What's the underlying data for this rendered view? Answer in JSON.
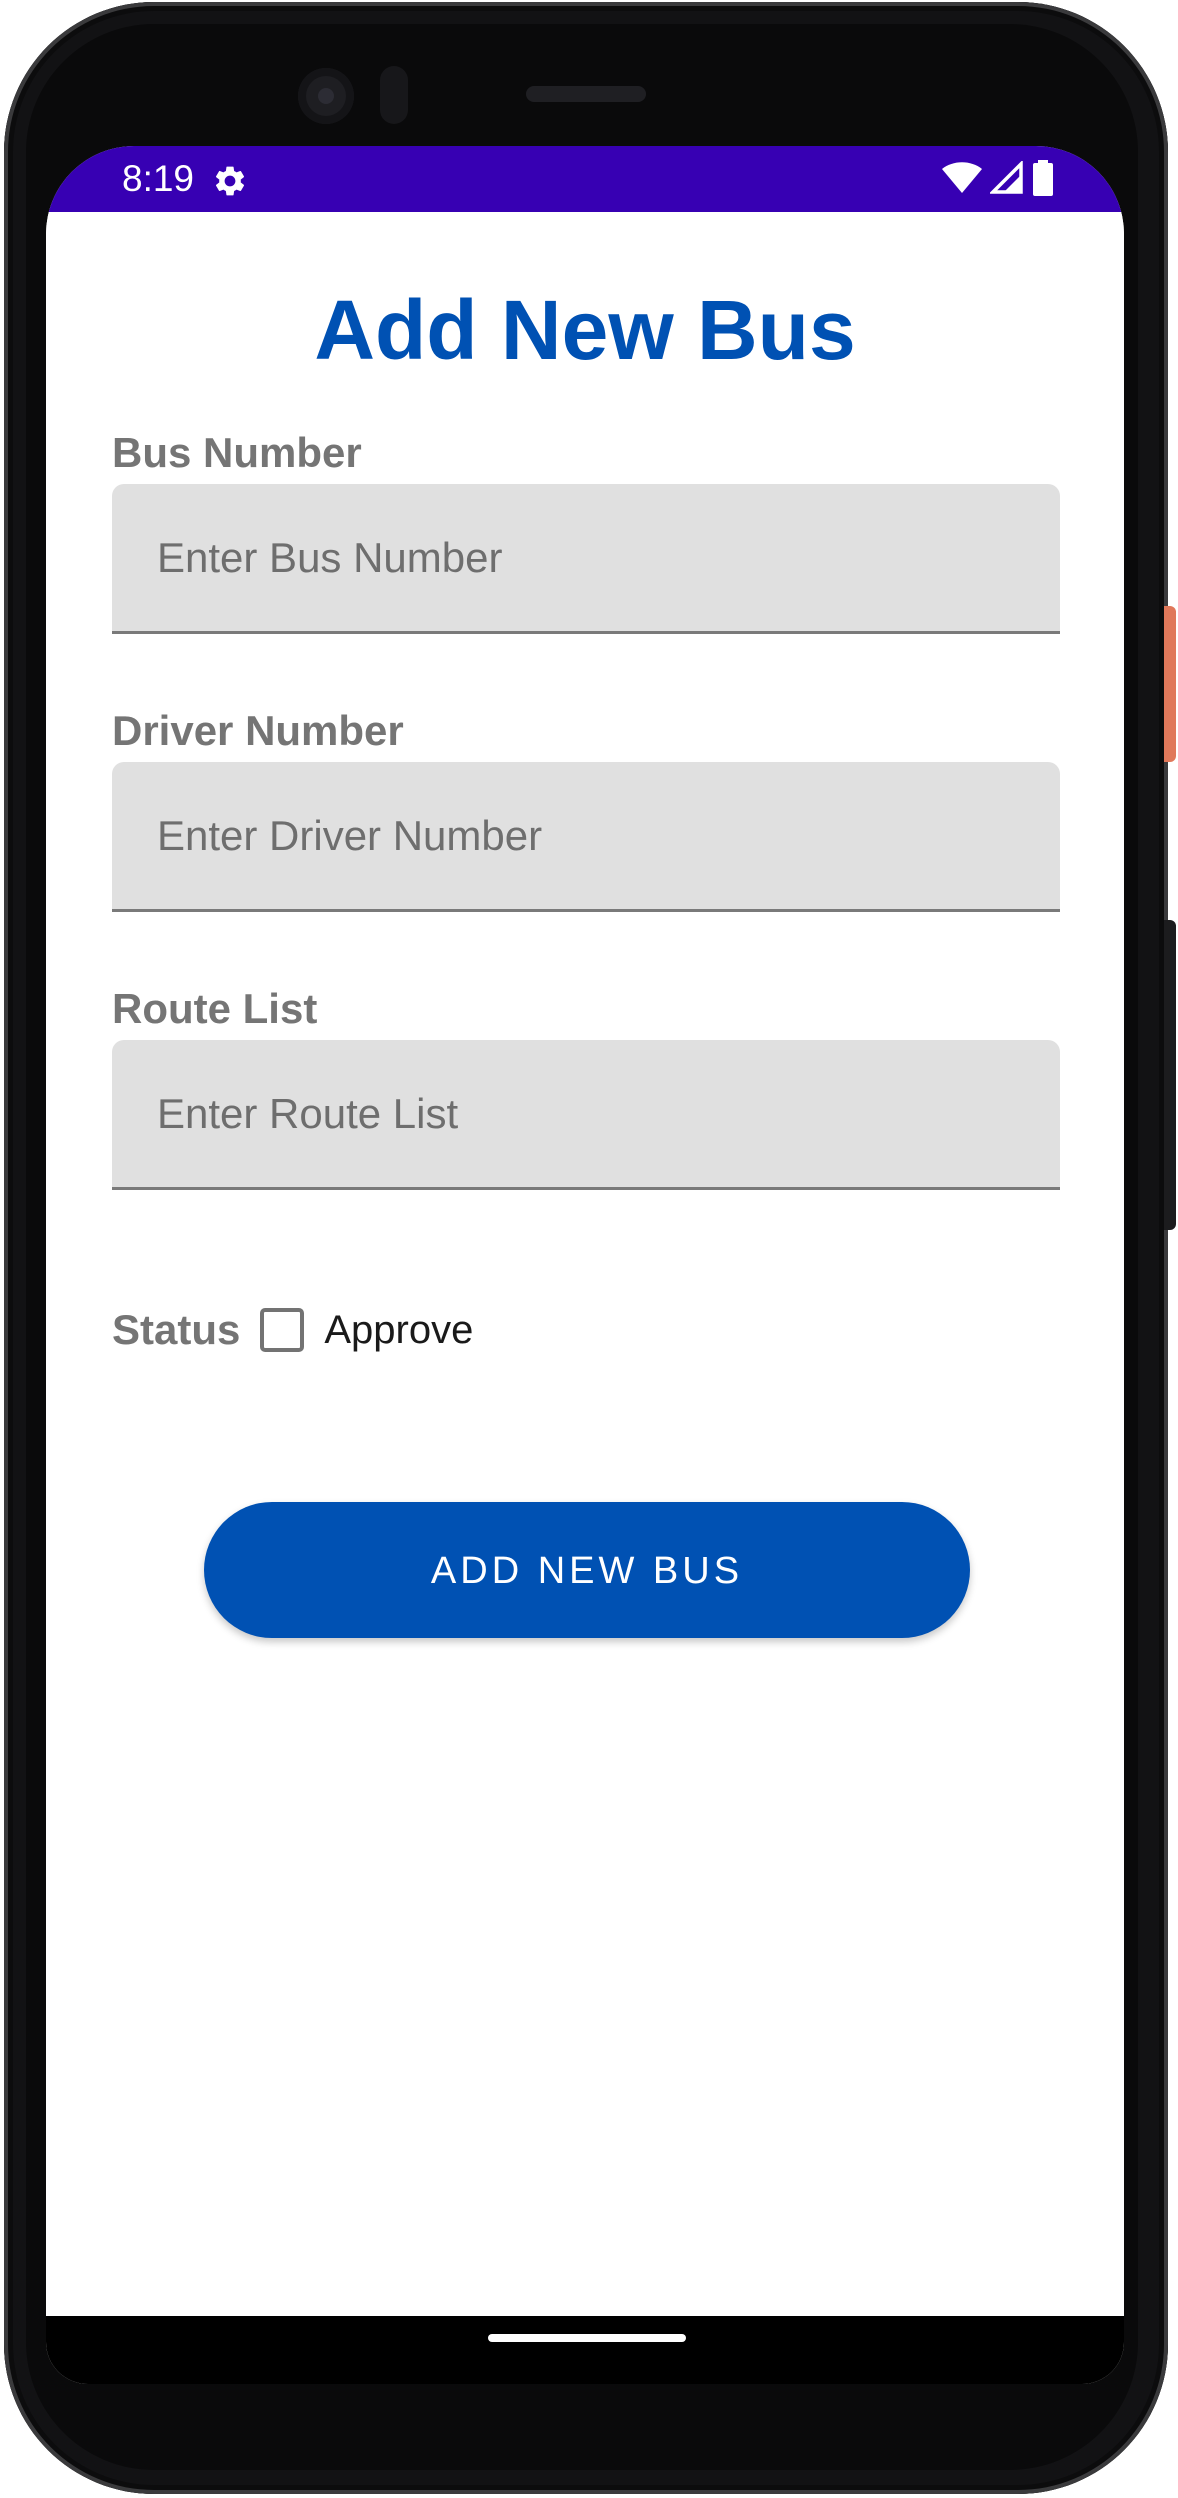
{
  "status_bar": {
    "time": "8:19",
    "settings_icon": "gear-icon",
    "wifi_icon": "wifi-icon",
    "signal_icon": "cell-signal-icon",
    "battery_icon": "battery-icon",
    "background_color": "#3700b3"
  },
  "page": {
    "title": "Add New Bus",
    "title_color": "#0051b3"
  },
  "form": {
    "bus_number": {
      "label": "Bus Number",
      "value": "",
      "placeholder": "Enter Bus Number"
    },
    "driver_number": {
      "label": "Driver Number",
      "value": "",
      "placeholder": "Enter Driver Number"
    },
    "route_list": {
      "label": "Route List",
      "value": "",
      "placeholder": "Enter Route List"
    },
    "status": {
      "label": "Status",
      "checkbox_label": "Approve",
      "checked": false
    },
    "submit_label": "ADD NEW BUS",
    "button_color": "#0051b3"
  }
}
